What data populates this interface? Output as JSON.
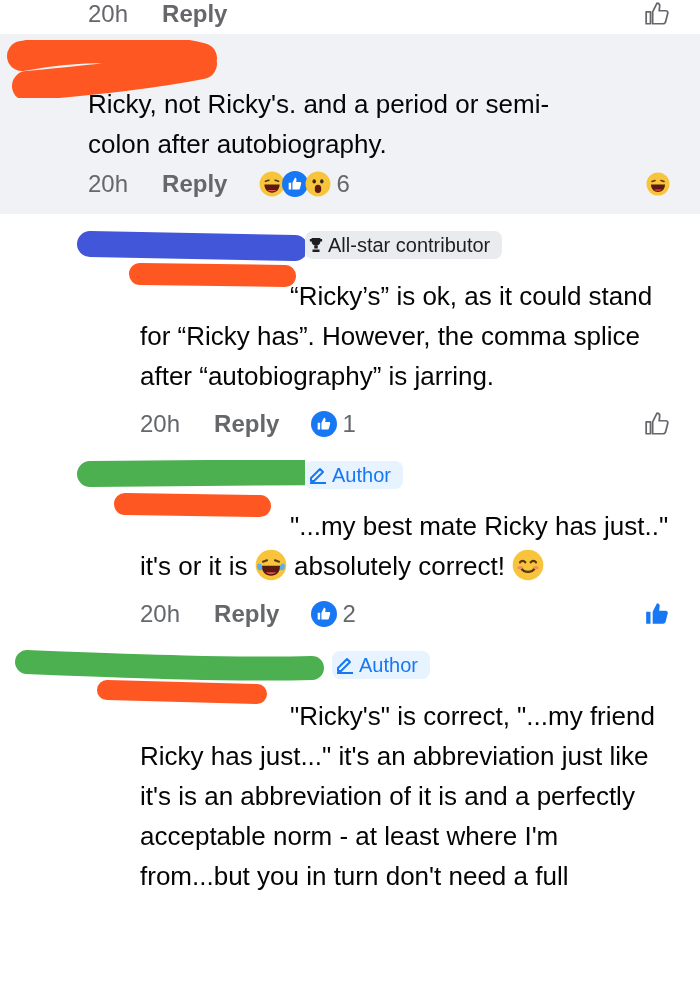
{
  "top_footer": {
    "time": "20h",
    "reply": "Reply"
  },
  "comments": [
    {
      "kind": "comment",
      "highlighted": true,
      "segments": [
        {
          "kind": "text",
          "text": "Ricky, not Ricky's. and a period or semi-colon after autobiography."
        }
      ],
      "time": "20h",
      "reply": "Reply",
      "reactions": [
        {
          "kind": "haha"
        },
        {
          "kind": "like"
        },
        {
          "kind": "wow"
        }
      ],
      "reaction_count": "6",
      "my_reaction": {
        "kind": "haha"
      }
    },
    {
      "kind": "reply",
      "highlighted": false,
      "badge": {
        "kind": "contributor",
        "label": "All-star contributor"
      },
      "segments": [
        {
          "kind": "text",
          "text": "“Ricky’s” is ok, as it could stand for “Ricky has”. However, the comma splice after “autobiography” is jarring."
        }
      ],
      "time": "20h",
      "reply": "Reply",
      "reactions": [
        {
          "kind": "like"
        }
      ],
      "reaction_count": "1"
    },
    {
      "kind": "reply",
      "highlighted": false,
      "badge": {
        "kind": "author",
        "label": "Author"
      },
      "segments": [
        {
          "kind": "text",
          "text": "\"...my best mate Ricky has just..\" it's or it is "
        },
        {
          "kind": "laughing_emoji"
        },
        {
          "kind": "text",
          "text": " absolutely correct! "
        },
        {
          "kind": "smiling_emoji"
        }
      ],
      "time": "20h",
      "reply": "Reply",
      "reactions": [
        {
          "kind": "like"
        }
      ],
      "reaction_count": "2",
      "my_reaction": {
        "kind": "like"
      }
    },
    {
      "kind": "reply",
      "highlighted": false,
      "badge": {
        "kind": "author",
        "label": "Author"
      },
      "segments": [
        {
          "kind": "text",
          "text": "\"Ricky's\" is correct, \"...my friend Ricky has just...\" it's an abbreviation just like it's is an abbreviation of it is and a perfectly acceptable norm - at least where I'm from...but you in turn don't need a full"
        }
      ]
    }
  ]
}
